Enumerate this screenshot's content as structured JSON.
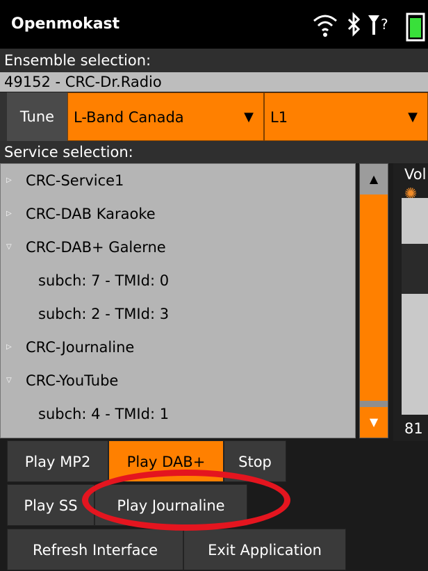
{
  "app": {
    "title": "Openmokast"
  },
  "status": {
    "wifi_icon": "wifi-icon",
    "bluetooth_icon": "bluetooth-icon",
    "signal_icon": "signal-icon",
    "signal_text": "Y?",
    "battery_icon": "battery-icon"
  },
  "ensemble": {
    "label": "Ensemble selection:",
    "value": "49152 - CRC-Dr.Radio"
  },
  "tune": {
    "button_label": "Tune",
    "band": "L-Band Canada",
    "channel": "L1"
  },
  "services": {
    "label": "Service selection:",
    "items": [
      {
        "label": "CRC-Service1",
        "kind": "collapsed"
      },
      {
        "label": "CRC-DAB Karaoke",
        "kind": "collapsed"
      },
      {
        "label": "CRC-DAB+ Galerne",
        "kind": "expanded"
      },
      {
        "label": "subch: 7 - TMId: 0",
        "kind": "child"
      },
      {
        "label": "subch: 2 - TMId: 3",
        "kind": "child"
      },
      {
        "label": "CRC-Journaline",
        "kind": "collapsed"
      },
      {
        "label": "CRC-YouTube",
        "kind": "expanded"
      },
      {
        "label": "subch: 4 - TMId: 1",
        "kind": "child"
      }
    ]
  },
  "volume": {
    "label": "Vol",
    "value": "81",
    "level": 0.81
  },
  "buttons": {
    "play_mp2": "Play MP2",
    "play_dab_plus": "Play DAB+",
    "stop": "Stop",
    "play_ss": "Play SS",
    "play_journaline": "Play Journaline",
    "refresh_interface": "Refresh Interface",
    "exit_application": "Exit Application"
  },
  "colors": {
    "accent": "#ff8000",
    "annotation": "#e4151f"
  }
}
